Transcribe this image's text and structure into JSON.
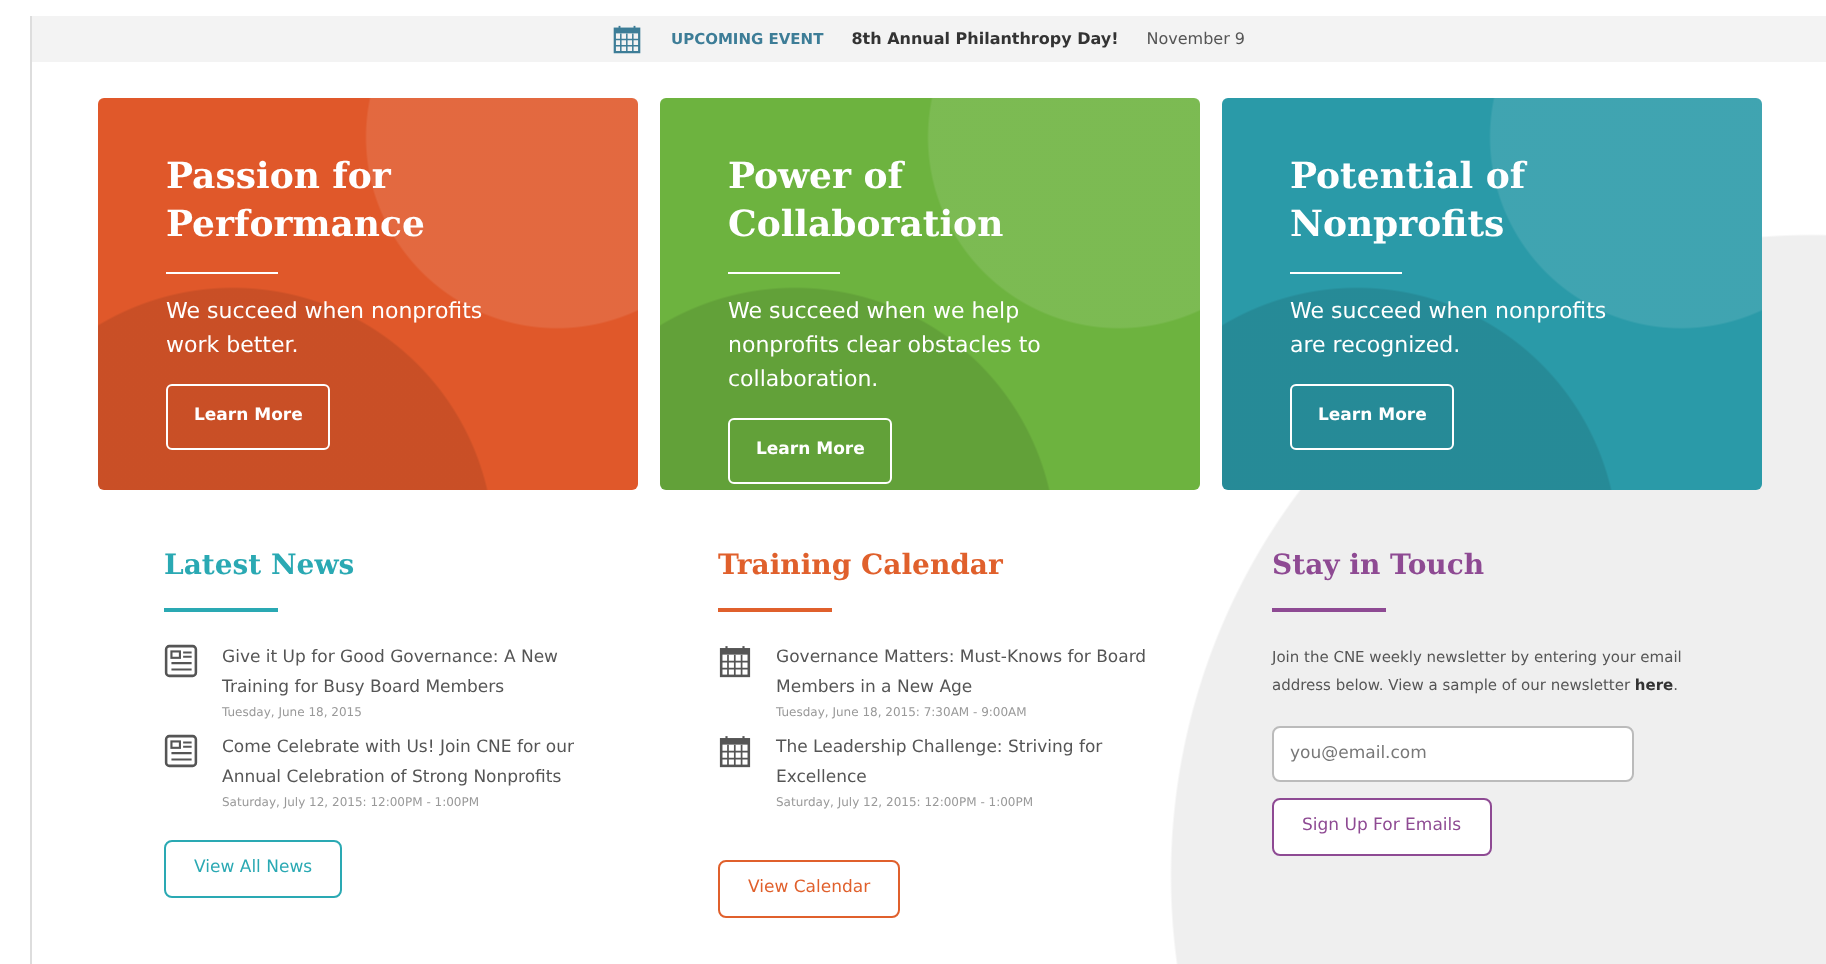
{
  "event_bar": {
    "label": "UPCOMING EVENT",
    "title": "8th Annual Philanthropy Day!",
    "date": "November 9"
  },
  "cards": [
    {
      "title": "Passion for Performance",
      "text": "We succeed when nonprofits work better.",
      "button": "Learn More",
      "color": "#e0582a"
    },
    {
      "title": "Power of Collaboration",
      "text": "We succeed when we help nonprofits clear obstacles to collaboration.",
      "button": "Learn More",
      "color": "#6db33f"
    },
    {
      "title": "Potential of Nonprofits",
      "text": "We succeed when nonprofits are recognized.",
      "button": "Learn More",
      "color": "#2a9aa8"
    }
  ],
  "news": {
    "heading": "Latest News",
    "color": "#2aa9b3",
    "items": [
      {
        "title": "Give it Up for Good Governance: A New Training for Busy Board Members",
        "date": "Tuesday, June 18, 2015"
      },
      {
        "title": "Come Celebrate with Us! Join CNE for our Annual Celebration of Strong Nonprofits",
        "date": "Saturday, July 12, 2015: 12:00PM - 1:00PM"
      }
    ],
    "button": "View All News"
  },
  "calendar": {
    "heading": "Training Calendar",
    "color": "#e0602c",
    "items": [
      {
        "title": "Governance Matters: Must-Knows for Board Members in a New Age",
        "date": "Tuesday, June 18, 2015: 7:30AM - 9:00AM"
      },
      {
        "title": "The Leadership Challenge: Striving for Excellence",
        "date": "Saturday, July 12, 2015: 12:00PM - 1:00PM"
      }
    ],
    "button": "View Calendar"
  },
  "newsletter": {
    "heading": "Stay in Touch",
    "color": "#8e4a93",
    "text": "Join the CNE weekly newsletter by entering your email address below. View a sample of our newsletter **here**.",
    "placeholder": "you@email.com",
    "button": "Sign Up For Emails"
  }
}
